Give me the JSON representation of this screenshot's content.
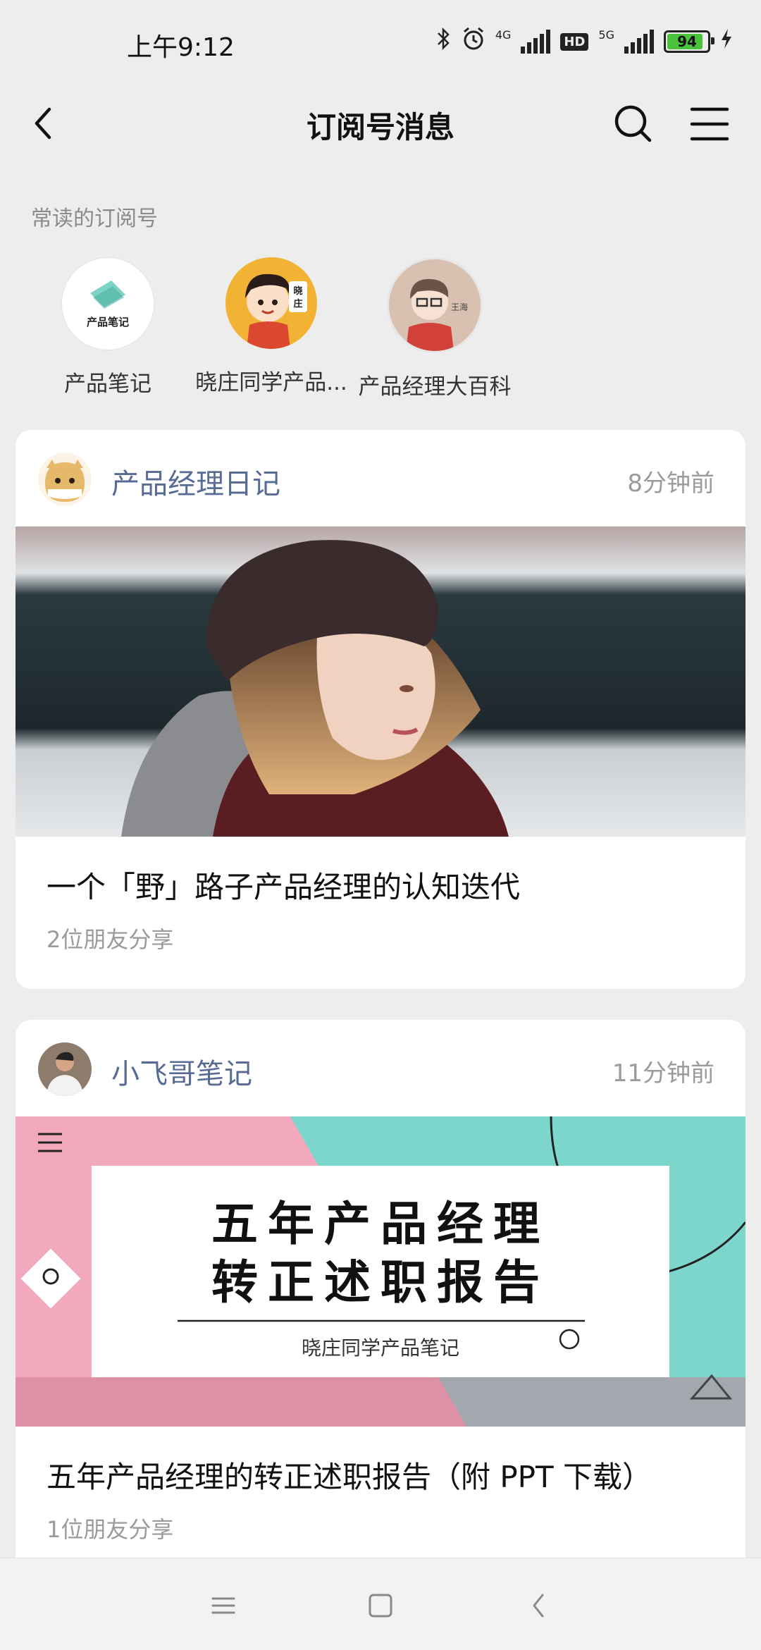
{
  "status_bar": {
    "time": "上午9:12",
    "net_4g": "4G",
    "net_5g": "5G",
    "hd": "HD",
    "battery": "94"
  },
  "nav": {
    "title": "订阅号消息"
  },
  "frequent": {
    "label": "常读的订阅号",
    "items": [
      {
        "name": "产品笔记",
        "avatar_text": "产品笔记"
      },
      {
        "name": "晓庄同学产品...",
        "avatar_text": "晓庄"
      },
      {
        "name": "产品经理大百科",
        "avatar_text": "王海"
      }
    ]
  },
  "articles": [
    {
      "source": "产品经理日记",
      "time": "8分钟前",
      "title": "一个「野」路子产品经理的认知迭代",
      "shares": "2位朋友分享"
    },
    {
      "source": "小飞哥笔记",
      "time": "11分钟前",
      "title": "五年产品经理的转正述职报告（附 PPT 下载）",
      "shares": "1位朋友分享",
      "cover": {
        "line1": "五年产品经理",
        "line2": "转正述职报告",
        "author": "晓庄同学产品笔记"
      }
    }
  ],
  "colors": {
    "link_blue": "#576b95",
    "bg": "#ededed",
    "battery_green": "#4bc23c"
  }
}
